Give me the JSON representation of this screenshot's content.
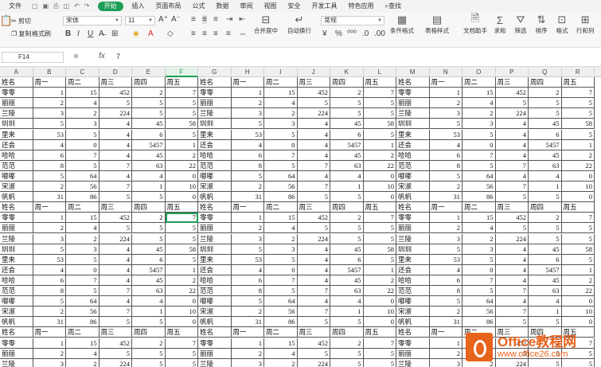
{
  "menubar": {
    "items": [
      "文件",
      "开始",
      "插入",
      "页面布局",
      "公式",
      "数据",
      "审阅",
      "视图",
      "安全",
      "开发工具",
      "特色应用"
    ],
    "active": "开始",
    "search": "查找"
  },
  "ribbon": {
    "cut": "剪切",
    "copy": "复制",
    "format_painter": "格式刷",
    "paste": "粘贴",
    "font_name": "宋体",
    "font_size": "11",
    "merge_center": "合并居中",
    "wrap_text": "自动换行",
    "number_format": "常规",
    "conditional_format": "条件格式",
    "table_style": "表格样式",
    "doc_assistant": "文档助手",
    "sum": "求和",
    "filter": "筛选",
    "sort": "排序",
    "format": "格式",
    "rows_cols": "行和列"
  },
  "formula_bar": {
    "name_box": "F14",
    "fx": "fx",
    "value": "7"
  },
  "sheet": {
    "columns": [
      "A",
      "B",
      "C",
      "D",
      "E",
      "F",
      "G",
      "H",
      "I",
      "J",
      "K",
      "L",
      "M",
      "N",
      "O",
      "P",
      "Q",
      "R"
    ],
    "selected_column": "F",
    "selected_row": 14,
    "header_row": [
      "姓名",
      "周一",
      "周二",
      "周三",
      "周四",
      "周五"
    ],
    "names": [
      "零零",
      "丽丽",
      "兰陵",
      "圳圳",
      "里来",
      "还会",
      "哈哈",
      "范范",
      "嘟嘟",
      "宋淑",
      "帆帆"
    ],
    "values": [
      [
        1,
        15,
        452,
        2,
        7
      ],
      [
        2,
        4,
        5,
        5,
        5
      ],
      [
        3,
        2,
        224,
        5,
        5
      ],
      [
        5,
        3,
        4,
        45,
        58
      ],
      [
        53,
        5,
        4,
        6,
        5
      ],
      [
        4,
        0,
        4,
        5457,
        1
      ],
      [
        6,
        7,
        4,
        45,
        2
      ],
      [
        8,
        5,
        7,
        63,
        22
      ],
      [
        5,
        64,
        4,
        4,
        0
      ],
      [
        2,
        56,
        7,
        1,
        10
      ],
      [
        31,
        86,
        5,
        5,
        0
      ]
    ]
  },
  "watermark": {
    "title": "Office教程网",
    "url": "www.office26.com"
  }
}
